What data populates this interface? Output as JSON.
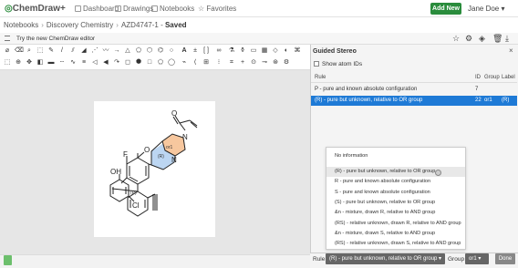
{
  "app": {
    "logo_prefix": "",
    "logo_o": "",
    "logo_text": "ChemDraw+",
    "nav": [
      {
        "label": "Dashboard"
      },
      {
        "label": "Drawings"
      },
      {
        "label": "Notebooks"
      },
      {
        "label": "Favorites"
      }
    ],
    "add_new": "Add New ▾",
    "user": "Jane Doe ▾"
  },
  "breadcrumb": {
    "items": [
      "Notebooks",
      "Discovery Chemistry",
      "AZD4747-1"
    ],
    "status": "Saved"
  },
  "editor_bar": {
    "label": "Try the new ChemDraw editor"
  },
  "panel": {
    "title": "Guided Stereo",
    "show_atom_ids": "Show atom IDs",
    "columns": {
      "rule": "Rule",
      "id": "ID",
      "group": "Group",
      "label": "Label"
    },
    "rows": [
      {
        "rule": "P - pure and known absolute configuration",
        "id": "7",
        "group": "",
        "label": ""
      },
      {
        "rule": "(R) - pure but unknown, relative to OR group",
        "id": "22",
        "group": "or1",
        "label": "(R)"
      }
    ],
    "dropdown_options": [
      "No information",
      "(R) - pure but unknown, relative to OR group",
      "R - pure and known absolute configuration",
      "S - pure and known absolute configuration",
      "(S) - pure but unknown, relative to OR group",
      "&n - mixture, drawn R, relative to AND group",
      "(RS) - relative unknown, drawn R, relative to AND group",
      "&n - mixture, drawn S, relative to AND group",
      "(RS) - relative unknown, drawn S, relative to AND group"
    ],
    "rule_label": "Rule",
    "rule_value": "(R) - pure but unknown, relative to OR group  ▾",
    "group_label": "Group",
    "group_value": "or1 ▾",
    "done": "Done"
  },
  "molecule": {
    "atoms": {
      "O_top": "O",
      "N_ring": "N",
      "N_amide": "N",
      "O_ring": "O",
      "F": "F",
      "OH": "OH",
      "Cl": "Cl",
      "or1": "or1",
      "R": "(R)",
      "P": "(P)"
    }
  },
  "colors": {
    "brand_green": "#2a8c3c",
    "selection_blue": "#1e7ad6"
  }
}
